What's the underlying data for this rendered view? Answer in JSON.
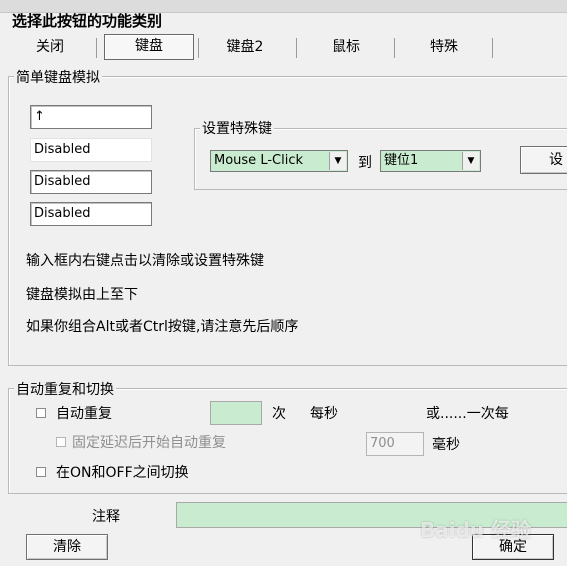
{
  "dialog": {
    "title": "选择此按钮的功能类别"
  },
  "tabs": [
    {
      "label": "关闭"
    },
    {
      "label": "键盘"
    },
    {
      "label": "键盘2"
    },
    {
      "label": "鼠标"
    },
    {
      "label": "特殊"
    }
  ],
  "simple_keyboard": {
    "title": "简单键盘模拟",
    "fields": [
      {
        "value": "↑"
      },
      {
        "value": "Disabled"
      },
      {
        "value": "Disabled"
      },
      {
        "value": "Disabled"
      }
    ],
    "special_key": {
      "title": "设置特殊键",
      "source_select": "Mouse L-Click",
      "to_label": "到",
      "target_select": "键位1",
      "set_button": "设"
    },
    "hints": [
      "输入框内右键点击以清除或设置特殊键",
      "键盘模拟由上至下",
      "如果你组合Alt或者Ctrl按键,请注意先后顺序"
    ]
  },
  "auto_repeat": {
    "title": "自动重复和切换",
    "auto_repeat_label": "自动重复",
    "times_unit": "次",
    "per_second": "每秒",
    "or_once_each": "或......一次每",
    "fixed_delay_label": "固定延迟后开始自动重复",
    "delay_value": "700",
    "ms_unit": "毫秒",
    "toggle_label": "在ON和OFF之间切换"
  },
  "footer": {
    "note_label": "注释",
    "clear_button": "清除",
    "ok_button": "确定",
    "watermark": "Baidu 经验"
  }
}
